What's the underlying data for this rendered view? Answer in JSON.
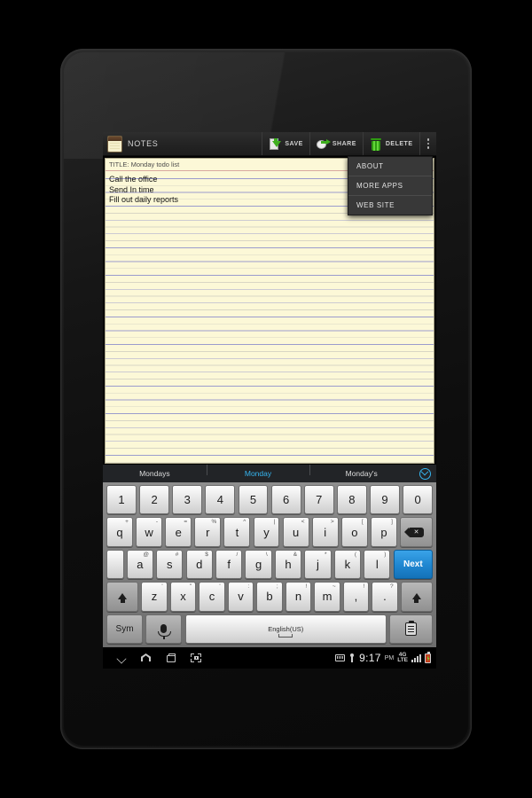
{
  "app": {
    "title": "NOTES",
    "icon": "notepad-icon"
  },
  "toolbar": {
    "save_label": "SAVE",
    "share_label": "SHARE",
    "delete_label": "DELETE",
    "overflow_label": "More options"
  },
  "menu": {
    "items": [
      {
        "label": "ABOUT"
      },
      {
        "label": "MORE APPS"
      },
      {
        "label": "WEB SITE"
      }
    ]
  },
  "note": {
    "title_line": "TITLE: Monday todo list",
    "lines": [
      "Call the office",
      "Send In time",
      "Fill out daily reports"
    ]
  },
  "suggestions": {
    "items": [
      {
        "text": "Mondays",
        "selected": false
      },
      {
        "text": "Monday",
        "selected": true
      },
      {
        "text": "Monday's",
        "selected": false
      }
    ],
    "expand_icon": "chevron-down-circle-icon"
  },
  "keyboard": {
    "language": "English(US)",
    "rows": {
      "numbers": [
        "1",
        "2",
        "3",
        "4",
        "5",
        "6",
        "7",
        "8",
        "9",
        "0"
      ],
      "top": [
        {
          "main": "q",
          "alt": "+"
        },
        {
          "main": "w",
          "alt": "-"
        },
        {
          "main": "e",
          "alt": "="
        },
        {
          "main": "r",
          "alt": "%"
        },
        {
          "main": "t",
          "alt": "^"
        },
        {
          "main": "y",
          "alt": "|"
        },
        {
          "main": "u",
          "alt": "<"
        },
        {
          "main": "i",
          "alt": ">"
        },
        {
          "main": "o",
          "alt": "["
        },
        {
          "main": "p",
          "alt": "]"
        }
      ],
      "home": [
        {
          "main": "a",
          "alt": "@"
        },
        {
          "main": "s",
          "alt": "#"
        },
        {
          "main": "d",
          "alt": "$"
        },
        {
          "main": "f",
          "alt": "/"
        },
        {
          "main": "g",
          "alt": "\\"
        },
        {
          "main": "h",
          "alt": "&"
        },
        {
          "main": "j",
          "alt": "*"
        },
        {
          "main": "k",
          "alt": "("
        },
        {
          "main": "l",
          "alt": ")"
        }
      ],
      "bottom": [
        {
          "main": "z",
          "alt": "'"
        },
        {
          "main": "x",
          "alt": "\""
        },
        {
          "main": "c",
          "alt": "'"
        },
        {
          "main": "v",
          "alt": ":"
        },
        {
          "main": "b",
          "alt": ";"
        },
        {
          "main": "n",
          "alt": "!"
        },
        {
          "main": "m",
          "alt": "~"
        },
        {
          "main": ",",
          "alt": "!"
        },
        {
          "main": ".",
          "alt": "?"
        }
      ]
    },
    "enter_label": "Next",
    "sym_label": "Sym",
    "backspace_icon": "backspace-icon",
    "mic_icon": "microphone-icon",
    "shift_icon": "shift-icon",
    "clipboard_icon": "clipboard-icon"
  },
  "navbar": {
    "back_icon": "chevron-down-icon",
    "home_icon": "home-icon",
    "recents_icon": "recent-apps-icon",
    "screenshot_icon": "screenshot-icon"
  },
  "statusbar": {
    "keyboard_icon": "keyboard-icon",
    "usb_icon": "usb-icon",
    "time": "9:17",
    "ampm": "PM",
    "network": "4G",
    "network_sub": "LTE",
    "signal_icon": "signal-bars-icon",
    "battery_icon": "battery-charging-icon"
  },
  "colors": {
    "accent": "#35b5f0",
    "paper": "#fcf8d7",
    "rule_blue": "#9b9ccd",
    "rule_gray": "#d9d6c4",
    "key_blue": "#1f86d0",
    "battery_red": "#c23b1e"
  }
}
